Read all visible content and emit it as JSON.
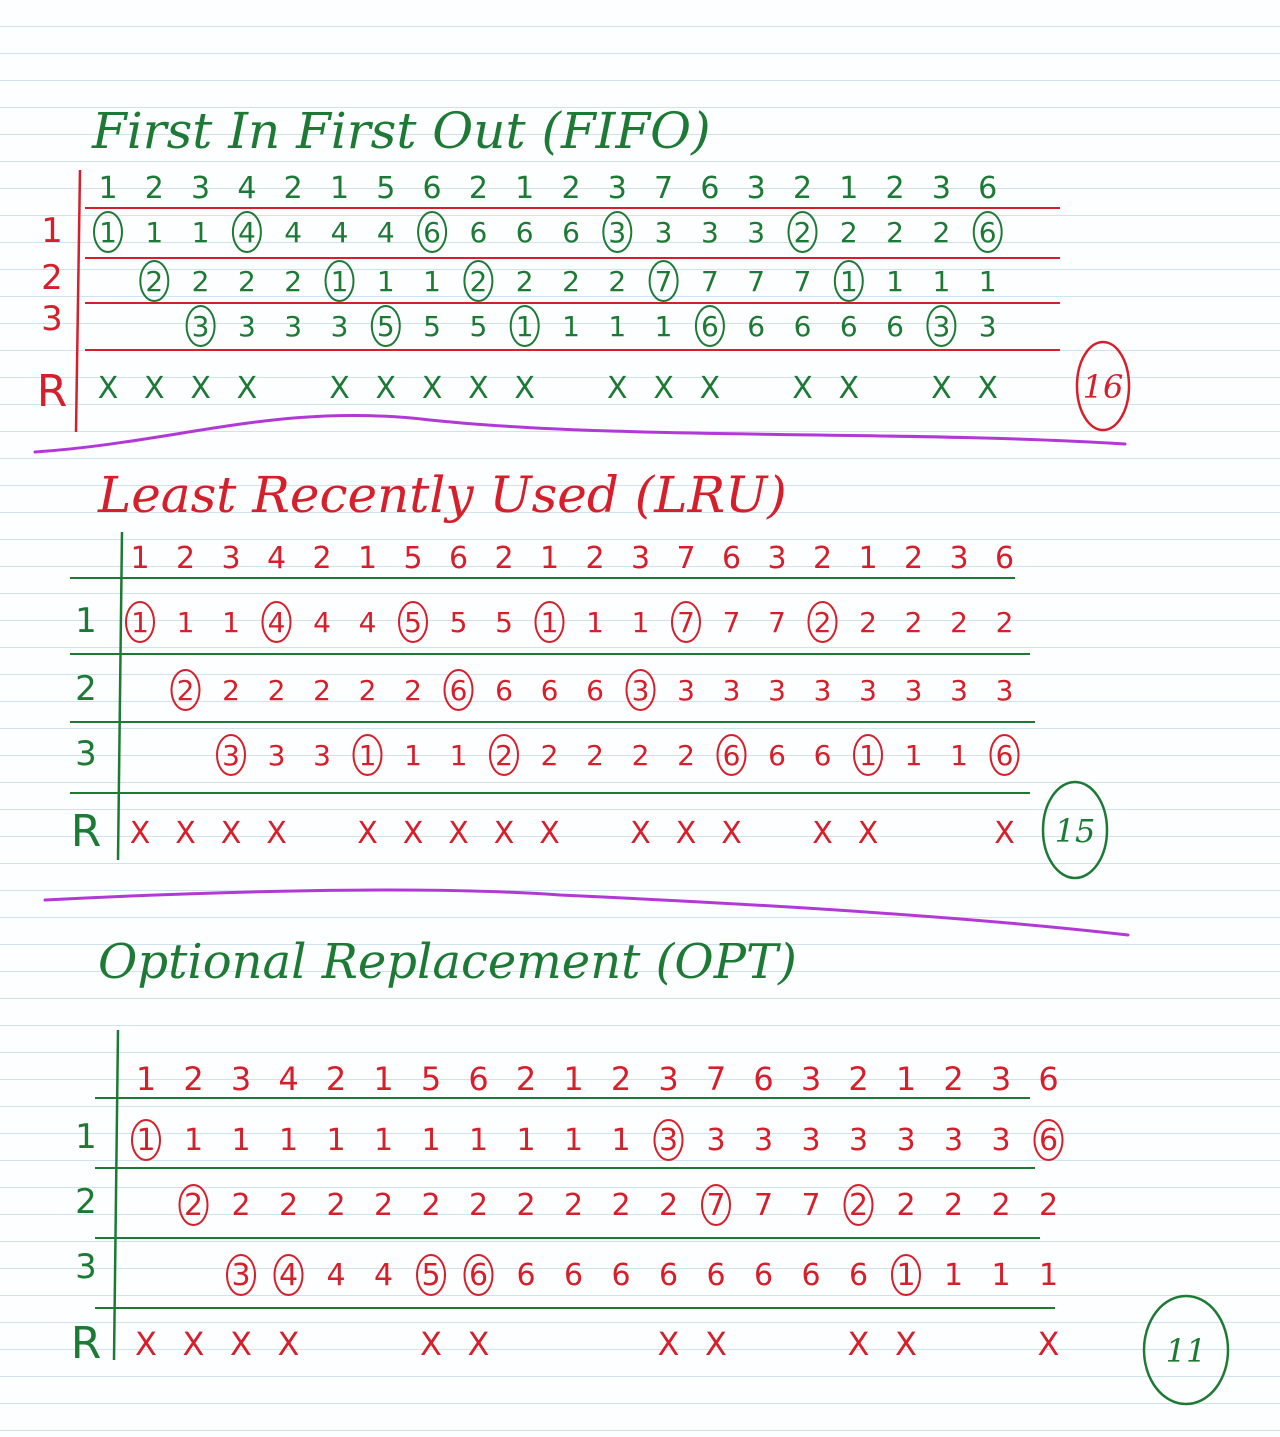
{
  "colors": {
    "green": "#1d7a35",
    "red": "#d61f2a",
    "purple": "#b13ad6",
    "page_lines": "#cfe3ee"
  },
  "row_labels": [
    "1",
    "2",
    "3",
    "R"
  ],
  "sections": [
    {
      "title": "First In First Out (FIFO)",
      "title_color": "green",
      "table_color": "red",
      "ink_color": "green",
      "reference_string": [
        "1",
        "2",
        "3",
        "4",
        "2",
        "1",
        "5",
        "6",
        "2",
        "1",
        "2",
        "3",
        "7",
        "6",
        "3",
        "2",
        "1",
        "2",
        "3",
        "6"
      ],
      "frames": [
        [
          "1",
          "1",
          "1",
          "4",
          "4",
          "4",
          "4",
          "6",
          "6",
          "6",
          "6",
          "3",
          "3",
          "3",
          "3",
          "2",
          "2",
          "2",
          "2",
          "6"
        ],
        [
          "",
          "2",
          "2",
          "2",
          "2",
          "1",
          "1",
          "1",
          "2",
          "2",
          "2",
          "2",
          "7",
          "7",
          "7",
          "7",
          "1",
          "1",
          "1",
          "1"
        ],
        [
          "",
          "",
          "3",
          "3",
          "3",
          "3",
          "5",
          "5",
          "5",
          "1",
          "1",
          "1",
          "1",
          "6",
          "6",
          "6",
          "6",
          "6",
          "3",
          "3"
        ]
      ],
      "circled": [
        [
          true,
          false,
          false,
          true,
          false,
          false,
          false,
          true,
          false,
          false,
          false,
          true,
          false,
          false,
          false,
          true,
          false,
          false,
          false,
          true
        ],
        [
          false,
          true,
          false,
          false,
          false,
          true,
          false,
          false,
          true,
          false,
          false,
          false,
          true,
          false,
          false,
          false,
          true,
          false,
          false,
          false
        ],
        [
          false,
          false,
          true,
          false,
          false,
          false,
          true,
          false,
          false,
          true,
          false,
          false,
          false,
          true,
          false,
          false,
          false,
          false,
          true,
          false
        ]
      ],
      "faults": [
        true,
        true,
        true,
        true,
        false,
        true,
        true,
        true,
        true,
        true,
        false,
        true,
        true,
        true,
        false,
        true,
        true,
        false,
        true,
        true
      ],
      "fault_mark": "X",
      "total": "16",
      "total_color": "red"
    },
    {
      "title": "Least Recently Used (LRU)",
      "title_color": "red",
      "table_color": "green",
      "ink_color": "red",
      "reference_string": [
        "1",
        "2",
        "3",
        "4",
        "2",
        "1",
        "5",
        "6",
        "2",
        "1",
        "2",
        "3",
        "7",
        "6",
        "3",
        "2",
        "1",
        "2",
        "3",
        "6"
      ],
      "frames": [
        [
          "1",
          "1",
          "1",
          "4",
          "4",
          "4",
          "5",
          "5",
          "5",
          "1",
          "1",
          "1",
          "7",
          "7",
          "7",
          "2",
          "2",
          "2",
          "2",
          "2"
        ],
        [
          "",
          "2",
          "2",
          "2",
          "2",
          "2",
          "2",
          "6",
          "6",
          "6",
          "6",
          "3",
          "3",
          "3",
          "3",
          "3",
          "3",
          "3",
          "3",
          "3"
        ],
        [
          "",
          "",
          "3",
          "3",
          "3",
          "1",
          "1",
          "1",
          "2",
          "2",
          "2",
          "2",
          "2",
          "6",
          "6",
          "6",
          "1",
          "1",
          "1",
          "6"
        ]
      ],
      "circled": [
        [
          true,
          false,
          false,
          true,
          false,
          false,
          true,
          false,
          false,
          true,
          false,
          false,
          true,
          false,
          false,
          true,
          false,
          false,
          false,
          false
        ],
        [
          false,
          true,
          false,
          false,
          false,
          false,
          false,
          true,
          false,
          false,
          false,
          true,
          false,
          false,
          false,
          false,
          false,
          false,
          false,
          false
        ],
        [
          false,
          false,
          true,
          false,
          false,
          true,
          false,
          false,
          true,
          false,
          false,
          false,
          false,
          true,
          false,
          false,
          true,
          false,
          false,
          true
        ]
      ],
      "faults": [
        true,
        true,
        true,
        true,
        false,
        true,
        true,
        true,
        true,
        true,
        false,
        true,
        true,
        true,
        false,
        true,
        true,
        false,
        false,
        true
      ],
      "fault_mark": "X",
      "total": "15",
      "total_color": "green"
    },
    {
      "title": "Optional Replacement (OPT)",
      "title_color": "green",
      "table_color": "green",
      "ink_color": "red",
      "reference_string": [
        "1",
        "2",
        "3",
        "4",
        "2",
        "1",
        "5",
        "6",
        "2",
        "1",
        "2",
        "3",
        "7",
        "6",
        "3",
        "2",
        "1",
        "2",
        "3",
        "6"
      ],
      "frames": [
        [
          "1",
          "1",
          "1",
          "1",
          "1",
          "1",
          "1",
          "1",
          "1",
          "1",
          "1",
          "3",
          "3",
          "3",
          "3",
          "3",
          "3",
          "3",
          "3",
          "6"
        ],
        [
          "",
          "2",
          "2",
          "2",
          "2",
          "2",
          "2",
          "2",
          "2",
          "2",
          "2",
          "2",
          "7",
          "7",
          "7",
          "2",
          "2",
          "2",
          "2",
          "2"
        ],
        [
          "",
          "",
          "3",
          "4",
          "4",
          "4",
          "5",
          "6",
          "6",
          "6",
          "6",
          "6",
          "6",
          "6",
          "6",
          "6",
          "1",
          "1",
          "1",
          "1"
        ]
      ],
      "circled": [
        [
          true,
          false,
          false,
          false,
          false,
          false,
          false,
          false,
          false,
          false,
          false,
          true,
          false,
          false,
          false,
          false,
          false,
          false,
          false,
          true
        ],
        [
          false,
          true,
          false,
          false,
          false,
          false,
          false,
          false,
          false,
          false,
          false,
          false,
          true,
          false,
          false,
          true,
          false,
          false,
          false,
          false
        ],
        [
          false,
          false,
          true,
          true,
          false,
          false,
          true,
          true,
          false,
          false,
          false,
          false,
          false,
          false,
          false,
          false,
          true,
          false,
          false,
          false
        ]
      ],
      "faults": [
        true,
        true,
        true,
        true,
        false,
        false,
        true,
        true,
        false,
        false,
        false,
        true,
        true,
        false,
        false,
        true,
        true,
        false,
        false,
        true
      ],
      "fault_mark": "X",
      "total": "11",
      "total_color": "green"
    }
  ]
}
